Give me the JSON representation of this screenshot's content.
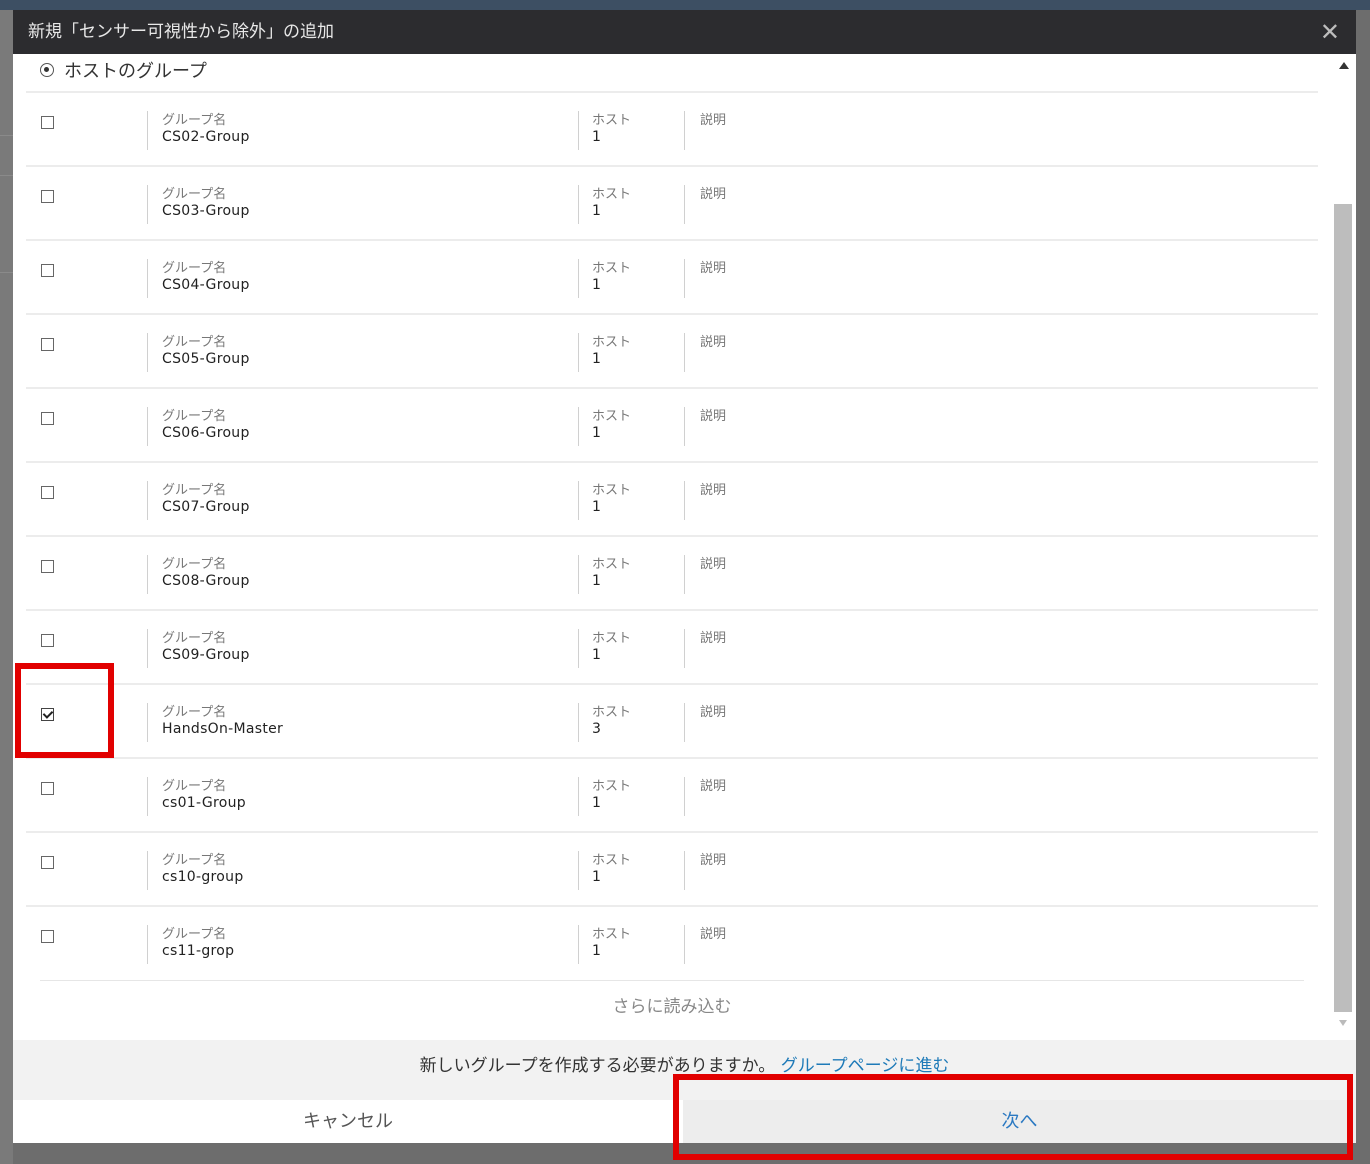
{
  "dialog": {
    "title": "新規「センサー可視性から除外」の追加",
    "close_icon": "✕"
  },
  "radio_option": {
    "label": "ホストのグループ",
    "selected": true
  },
  "columns": {
    "group_name": "グループ名",
    "hosts": "ホスト",
    "description": "説明"
  },
  "rows": [
    {
      "name": "CS02-Group",
      "hosts": "1",
      "checked": false
    },
    {
      "name": "CS03-Group",
      "hosts": "1",
      "checked": false
    },
    {
      "name": "CS04-Group",
      "hosts": "1",
      "checked": false
    },
    {
      "name": "CS05-Group",
      "hosts": "1",
      "checked": false
    },
    {
      "name": "CS06-Group",
      "hosts": "1",
      "checked": false
    },
    {
      "name": "CS07-Group",
      "hosts": "1",
      "checked": false
    },
    {
      "name": "CS08-Group",
      "hosts": "1",
      "checked": false
    },
    {
      "name": "CS09-Group",
      "hosts": "1",
      "checked": false
    },
    {
      "name": "HandsOn-Master",
      "hosts": "3",
      "checked": true
    },
    {
      "name": "cs01-Group",
      "hosts": "1",
      "checked": false
    },
    {
      "name": "cs10-group",
      "hosts": "1",
      "checked": false
    },
    {
      "name": "cs11-grop",
      "hosts": "1",
      "checked": false
    }
  ],
  "load_more": "さらに読み込む",
  "footer": {
    "question": "新しいグループを作成する必要がありますか。",
    "link": "グループページに進む",
    "cancel": "キャンセル",
    "next": "次へ"
  },
  "colors": {
    "header_bg": "#2c2c2f",
    "link": "#1e7ab8",
    "highlight": "#e10000"
  }
}
